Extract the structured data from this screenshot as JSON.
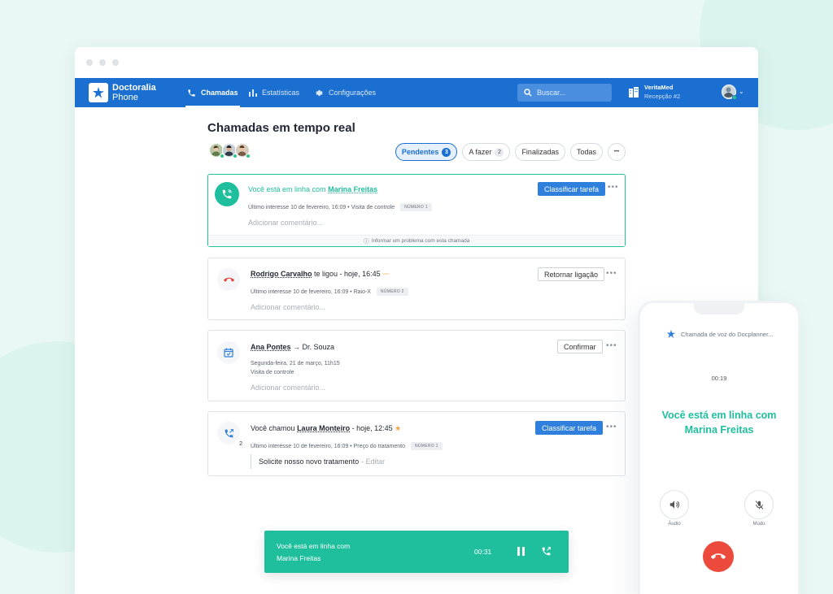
{
  "brand": {
    "name": "Doctoralia",
    "product": "Phone"
  },
  "nav": {
    "items": [
      {
        "label": "Chamadas",
        "icon": "phone-icon",
        "active": true
      },
      {
        "label": "Estatísticas",
        "icon": "bar-chart-icon",
        "active": false
      },
      {
        "label": "Configurações",
        "icon": "gear-icon",
        "active": false
      }
    ],
    "search_placeholder": "Buscar...",
    "clinic_name": "VeritaMed",
    "clinic_sub": "Recepção #2"
  },
  "page": {
    "title": "Chamadas em tempo real"
  },
  "filters": [
    {
      "label": "Pendentes",
      "count": "3",
      "active": true
    },
    {
      "label": "A fazer",
      "count": "2",
      "active": false
    },
    {
      "label": "Finalizadas",
      "count": "",
      "active": false
    },
    {
      "label": "Todas",
      "count": "",
      "active": false
    },
    {
      "label": "•••",
      "count": "",
      "active": false
    }
  ],
  "cards": {
    "live": {
      "text": "Você está em linha com",
      "name": "Marina Freitas",
      "meta": "Último interesse 10 de fevereiro, 16:09 • Visita de controle",
      "tag": "NÚMERO 1",
      "comment_placeholder": "Adicionar comentário...",
      "button": "Classificar tarefa",
      "report": "Informar um problema com esta chamada"
    },
    "missed": {
      "name": "Rodrigo Carvalho",
      "text": "te ligou - hoje, 16:45",
      "meta": "Último interesse 10 de fevereiro, 16:09 • Raio-X",
      "tag": "NÚMERO 2",
      "comment_placeholder": "Adicionar comentário...",
      "button": "Retornar ligação"
    },
    "appointment": {
      "name": "Ana Pontes",
      "text": "→ Dr. Souza",
      "meta1": "Segunda-feira, 21 de março, 11h15",
      "meta2": "Visita de controle",
      "comment_placeholder": "Adicionar comentário...",
      "button": "Confirmar"
    },
    "outgoing": {
      "prefix": "Você chamou",
      "name": "Laura Monteiro",
      "text": "- hoje, 12:45",
      "badge_count": "2",
      "meta": "Último interesse 10 de fevereiro, 16:09 • Preço do tratamento",
      "tag": "NÚMERO 1",
      "comment": "Solicite nosso novo tratamento",
      "edit": "- Editar",
      "button": "Classificar tarefa"
    }
  },
  "active_call_bar": {
    "line1": "Você está em linha com",
    "line2": "Marina Freitas",
    "timer": "00:31"
  },
  "phone": {
    "header": "Chamada de voz do Docplanner...",
    "timer": "00:19",
    "message_line1": "Você está em linha com",
    "message_line2": "Marina Freitas",
    "audio_label": "Áudio",
    "mute_label": "Mudo"
  },
  "colors": {
    "primary": "#1a6fd1",
    "accent": "#1fbf9e",
    "danger": "#ec4a3c"
  }
}
